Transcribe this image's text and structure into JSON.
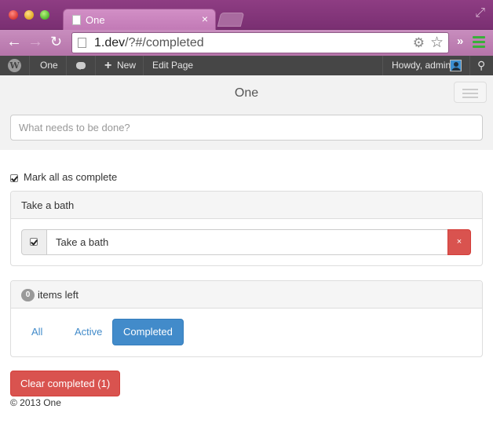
{
  "browser": {
    "tab_title": "One",
    "tab_close": "×",
    "url_domain": "1.dev",
    "url_path": "/?#/completed",
    "extensions_more": "»"
  },
  "adminbar": {
    "wp_logo": "W",
    "site_name": "One",
    "new_label": "New",
    "edit_page_label": "Edit Page",
    "howdy": "Howdy, admin"
  },
  "app": {
    "title": "One",
    "new_todo_placeholder": "What needs to be done?",
    "toggle_all_label": "Mark all as complete",
    "todo_panel_heading": "Take a bath",
    "todos": [
      {
        "title": "Take a bath",
        "completed": true
      }
    ],
    "destroy_label": "×",
    "items_left_count": "0",
    "items_left_label": "items left",
    "filters": [
      "All",
      "Active",
      "Completed"
    ],
    "selected_filter": "Completed",
    "clear_completed_label": "Clear completed (1)",
    "footer": "© 2013 One"
  },
  "colors": {
    "chrome_purple": "#8e3d83",
    "adminbar": "#464646",
    "primary": "#428bca",
    "danger": "#d9534f"
  }
}
